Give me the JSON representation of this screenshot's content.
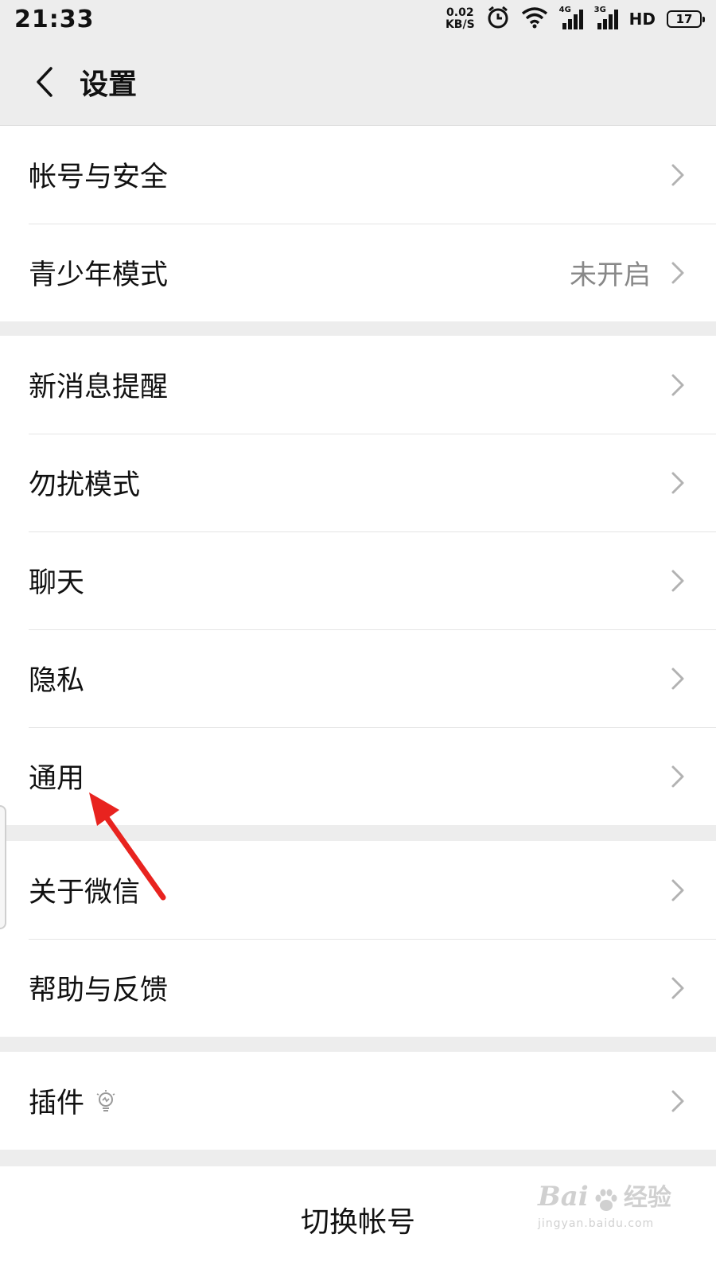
{
  "status_bar": {
    "time": "21:33",
    "net_speed_value": "0.02",
    "net_speed_unit": "KB/S",
    "signal_1_gen": "4G",
    "signal_2_gen": "3G",
    "hd": "HD",
    "battery": "17",
    "icons": [
      "alarm-icon",
      "wifi-icon",
      "signal-icon",
      "hd-voice-icon",
      "battery-icon"
    ]
  },
  "nav": {
    "title": "设置",
    "back_icon": "chevron-left-icon"
  },
  "groups": [
    {
      "items": [
        {
          "label": "帐号与安全",
          "value": ""
        },
        {
          "label": "青少年模式",
          "value": "未开启"
        }
      ]
    },
    {
      "items": [
        {
          "label": "新消息提醒",
          "value": ""
        },
        {
          "label": "勿扰模式",
          "value": ""
        },
        {
          "label": "聊天",
          "value": ""
        },
        {
          "label": "隐私",
          "value": ""
        },
        {
          "label": "通用",
          "value": ""
        }
      ]
    },
    {
      "items": [
        {
          "label": "关于微信",
          "value": ""
        },
        {
          "label": "帮助与反馈",
          "value": ""
        }
      ]
    },
    {
      "items": [
        {
          "label": "插件",
          "value": "",
          "icon": "lightbulb-icon"
        }
      ]
    }
  ],
  "switch_account": {
    "label": "切换帐号"
  },
  "annotation": {
    "color": "#e8231f",
    "icon": "red-arrow-icon"
  },
  "watermark": {
    "brand": "Bai",
    "brand_cn": "经验",
    "url": "jingyan.baidu.com"
  },
  "colors": {
    "background": "#ededed",
    "card": "#ffffff",
    "secondary_text": "#888888"
  }
}
